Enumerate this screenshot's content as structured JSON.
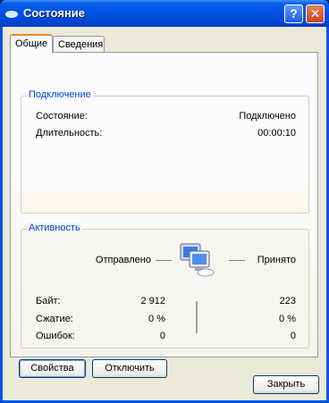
{
  "window": {
    "title": "Состояние",
    "help_label": "?",
    "close_label": "✕"
  },
  "tabs": [
    {
      "label": "Общие",
      "active": true
    },
    {
      "label": "Сведения",
      "active": false
    }
  ],
  "connection": {
    "group_title": "Подключение",
    "status_label": "Состояние:",
    "status_value": "Подключено",
    "duration_label": "Длительность:",
    "duration_value": "00:00:10"
  },
  "activity": {
    "group_title": "Активность",
    "sent_label": "Отправлено",
    "received_label": "Принято",
    "rows": [
      {
        "label": "Байт:",
        "sent": "2 912",
        "received": "223"
      },
      {
        "label": "Сжатие:",
        "sent": "0 %",
        "received": "0 %"
      },
      {
        "label": "Ошибок:",
        "sent": "0",
        "received": "0"
      }
    ]
  },
  "buttons": {
    "properties": "Свойства",
    "disconnect": "Отключить",
    "close": "Закрыть"
  },
  "colors": {
    "titlebar": "#0055e5",
    "group_title": "#0046d5",
    "dialog_bg": "#ece9d8"
  }
}
